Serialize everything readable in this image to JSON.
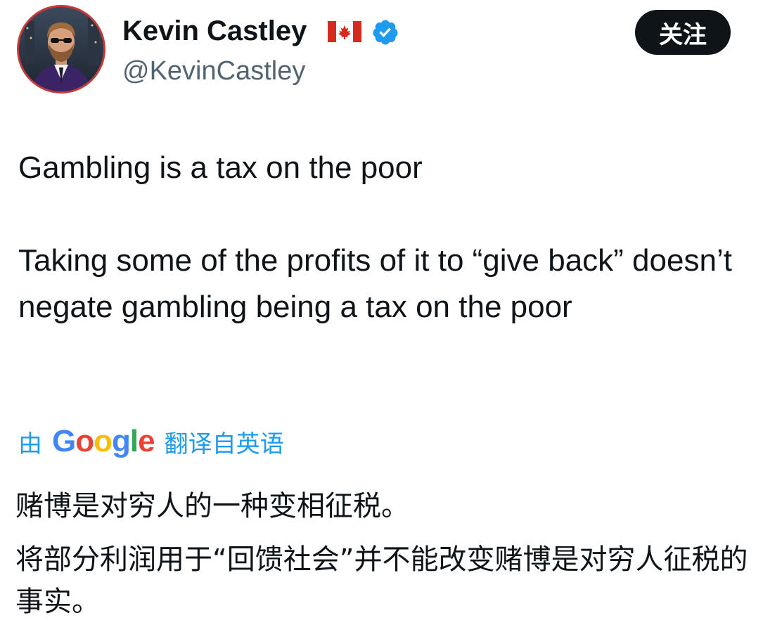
{
  "author": {
    "display_name": "Kevin Castley",
    "handle": "@KevinCastley",
    "flag_icon": "canada-flag-icon",
    "verified_icon": "verified-badge-icon",
    "verified_color": "#1d9bf0"
  },
  "follow_button": {
    "label": "关注"
  },
  "tweet": {
    "paragraph_1": "Gambling is a tax on the poor",
    "paragraph_2": "Taking some of the profits of it to “give back” doesn’t negate gambling being a tax on the poor"
  },
  "translation": {
    "by_label": "由",
    "provider": {
      "letter_1": "G",
      "letter_2": "o",
      "letter_3": "o",
      "letter_4": "g",
      "letter_5": "l",
      "letter_6": "e"
    },
    "from_label": "翻译自英语",
    "paragraph_1": "赌博是对穷人的一种变相征税。",
    "paragraph_2": "将部分利润用于“回馈社会”并不能改变赌博是对穷人征税的事实。"
  },
  "colors": {
    "link_blue": "#1d9bf0",
    "text_primary": "#0f1419",
    "text_secondary": "#536471",
    "button_bg": "#0f1419",
    "avatar_ring": "#c23a3a"
  }
}
